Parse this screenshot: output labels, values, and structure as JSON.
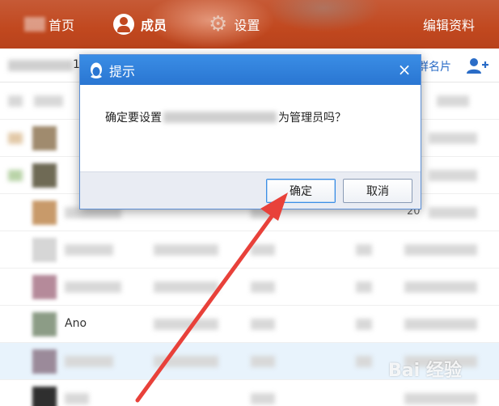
{
  "nav": {
    "home_label": "首页",
    "members_label": "成员",
    "settings_label": "设置",
    "edit_label": "编辑资料"
  },
  "subbar": {
    "digit": "1",
    "group_card_label": "群名片"
  },
  "table": {
    "rows": [
      {
        "name": "",
        "tail": ""
      },
      {
        "name": "",
        "tail": ""
      },
      {
        "name": "",
        "tail": ""
      },
      {
        "name": "",
        "tail": "20"
      },
      {
        "name": "",
        "tail": ""
      },
      {
        "name": "",
        "tail": ""
      },
      {
        "name": "Ano",
        "tail": ""
      },
      {
        "name": "",
        "tail": ""
      },
      {
        "name": "",
        "tail": ""
      }
    ]
  },
  "dialog": {
    "title": "提示",
    "message_prefix": "确定要设置",
    "message_suffix": "为管理员吗？",
    "ok_label": "确定",
    "cancel_label": "取消",
    "close_glyph": "×"
  },
  "watermark": "Bai 经验",
  "colors": {
    "topbar": "#c1481f",
    "dialog_title": "#2a76d2",
    "link": "#2a6cc7",
    "arrow": "#e8413a"
  }
}
